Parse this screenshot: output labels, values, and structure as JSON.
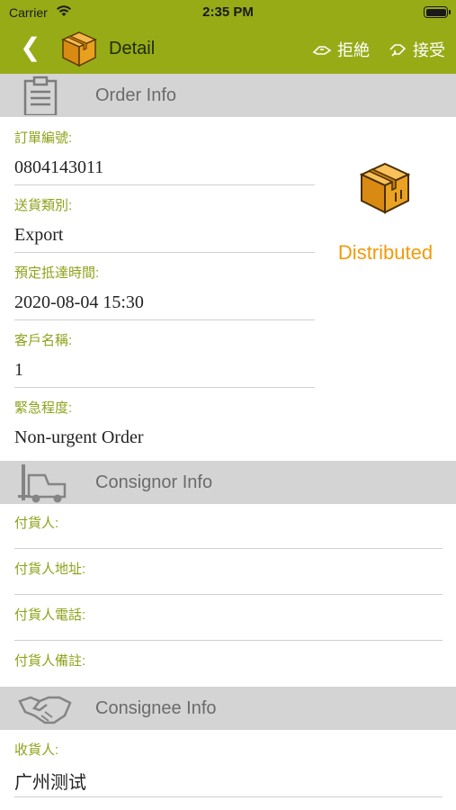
{
  "status_bar": {
    "carrier": "Carrier",
    "time": "2:35 PM"
  },
  "nav": {
    "back_label": "❮",
    "title": "Detail",
    "reject_label": "拒絶",
    "accept_label": "接受",
    "icons": {
      "back": "chevron-left-icon",
      "logo": "box-icon",
      "reject": "reject-icon",
      "accept": "accept-icon"
    }
  },
  "order_info": {
    "title": "Order Info",
    "fields": [
      {
        "label": "訂單編號:",
        "value": "0804143011"
      },
      {
        "label": "送貨類別:",
        "value": "Export"
      },
      {
        "label": "預定抵達時間:",
        "value": "2020-08-04 15:30"
      },
      {
        "label": "客戶名稱:",
        "value": "1"
      },
      {
        "label": "緊急程度:",
        "value": "Non-urgent Order"
      }
    ],
    "status_text": "Distributed",
    "status_color": "#f39a0a"
  },
  "consignor_info": {
    "title": "Consignor Info",
    "fields": [
      {
        "label": "付貨人:",
        "value": ""
      },
      {
        "label": "付貨人地址:",
        "value": ""
      },
      {
        "label": "付貨人電話:",
        "value": ""
      },
      {
        "label": "付貨人備註:",
        "value": ""
      }
    ]
  },
  "consignee_info": {
    "title": "Consignee Info",
    "fields": [
      {
        "label": "收貨人:",
        "value": "广州测试"
      }
    ]
  },
  "colors": {
    "nav_bg": "#97ab17",
    "label": "#8fa21a",
    "section_bg": "#d4d4d4"
  }
}
